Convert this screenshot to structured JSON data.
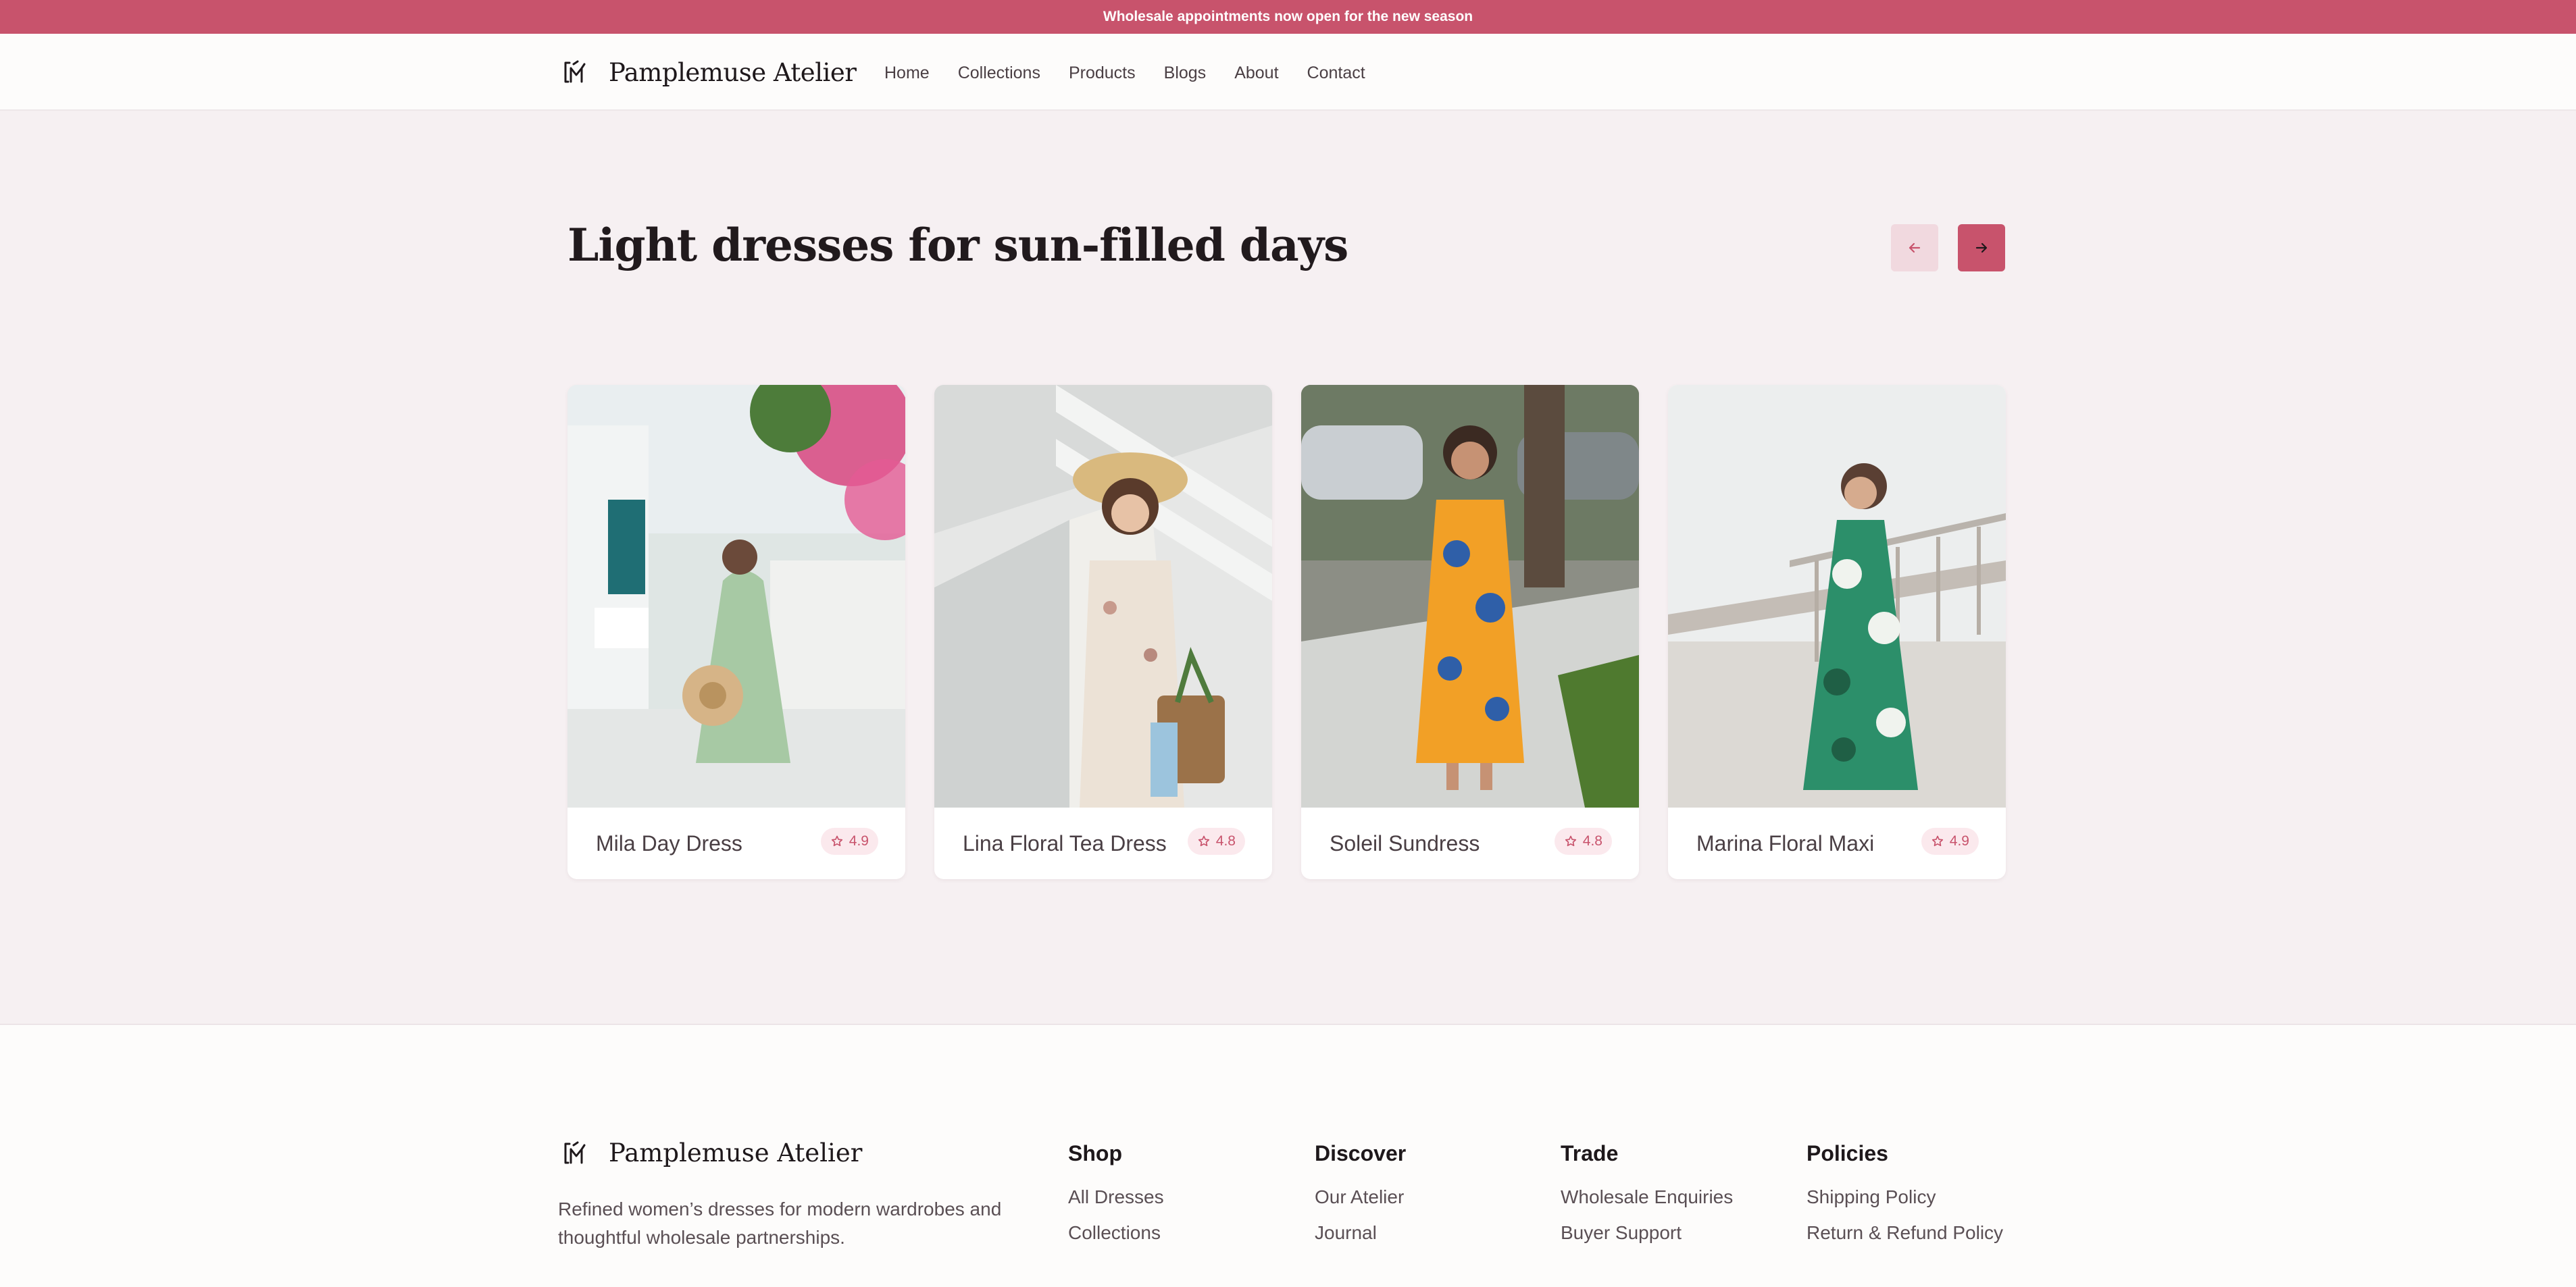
{
  "announcement": "Wholesale appointments now open for the new season",
  "brand": {
    "name": "Pamplemuse Atelier"
  },
  "nav": [
    "Home",
    "Collections",
    "Products",
    "Blogs",
    "About",
    "Contact"
  ],
  "hero": {
    "title": "Light dresses for sun-filled days"
  },
  "colors": {
    "accent": "#c8536c",
    "accent_soft": "#f1d9df",
    "hero_bg": "#f6f0f2"
  },
  "products": [
    {
      "name": "Mila Day Dress",
      "rating": "4.9"
    },
    {
      "name": "Lina Floral Tea Dress",
      "rating": "4.8"
    },
    {
      "name": "Soleil Sundress",
      "rating": "4.8"
    },
    {
      "name": "Marina Floral Maxi",
      "rating": "4.9"
    }
  ],
  "footer": {
    "tagline": "Refined women’s dresses for modern wardrobes and thoughtful wholesale partnerships.",
    "columns": [
      {
        "title": "Shop",
        "links": [
          "All Dresses",
          "Collections"
        ]
      },
      {
        "title": "Discover",
        "links": [
          "Our Atelier",
          "Journal"
        ]
      },
      {
        "title": "Trade",
        "links": [
          "Wholesale Enquiries",
          "Buyer Support"
        ]
      },
      {
        "title": "Policies",
        "links": [
          "Shipping Policy",
          "Return & Refund Policy"
        ]
      }
    ]
  }
}
